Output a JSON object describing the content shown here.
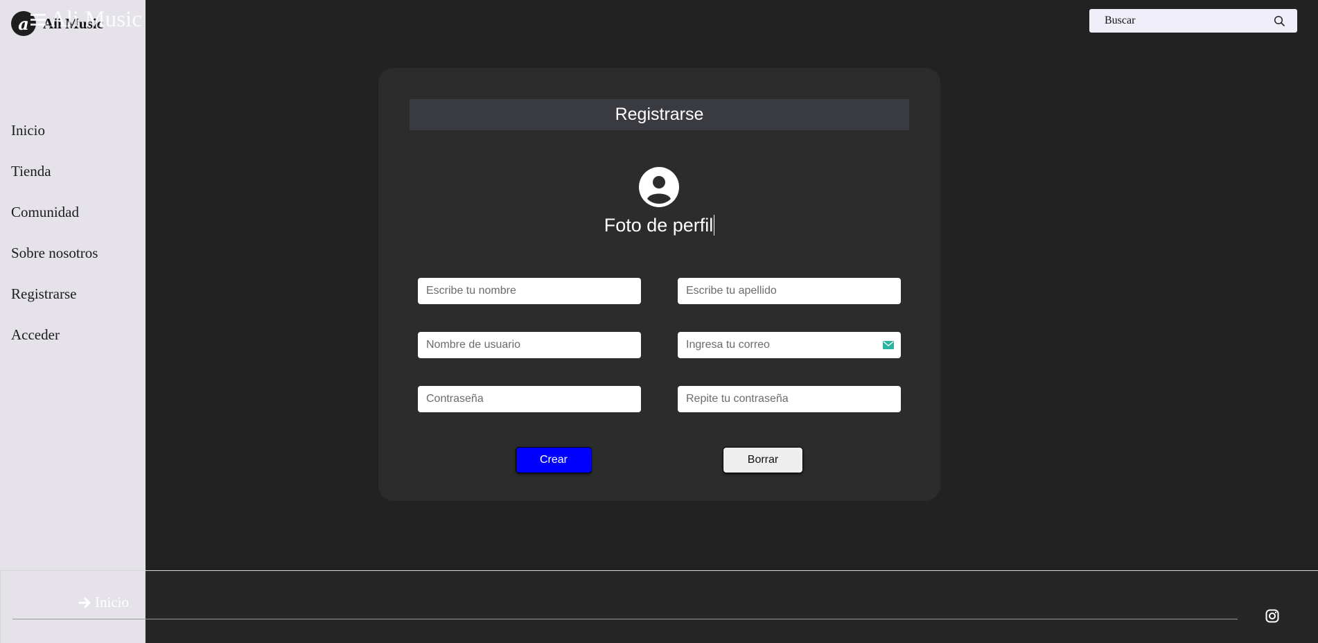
{
  "brand": {
    "logo_letter": "a",
    "name": "Ali Music",
    "ghost_title": "Ali Music"
  },
  "search": {
    "placeholder": "Buscar",
    "icon": "search-icon"
  },
  "nav": {
    "items": [
      {
        "label": "Inicio"
      },
      {
        "label": "Tienda"
      },
      {
        "label": "Comunidad"
      },
      {
        "label": "Sobre nosotros"
      },
      {
        "label": "Registrarse"
      },
      {
        "label": "Acceder"
      }
    ]
  },
  "form": {
    "title": "Registrarse",
    "avatar_icon": "user-avatar-icon",
    "photo_label": "Foto de perfil",
    "fields": {
      "first_name": {
        "placeholder": "Escribe tu nombre"
      },
      "last_name": {
        "placeholder": "Escribe tu apellido"
      },
      "username": {
        "placeholder": "Nombre de usuario"
      },
      "email": {
        "placeholder": "Ingresa tu correo",
        "icon": "mail-icon"
      },
      "password": {
        "placeholder": "Contraseña"
      },
      "password_repeat": {
        "placeholder": "Repite tu contraseña"
      }
    },
    "buttons": {
      "create": "Crear",
      "clear": "Borrar"
    }
  },
  "footer": {
    "link_label": "Inicio",
    "link_icon": "arrow-right-icon",
    "social_icon": "instagram-icon"
  },
  "colors": {
    "background": "#222222",
    "sidebar": "#e5e2ea",
    "card": "#2c2c2c",
    "card_header": "#3a3b41",
    "create_button": "#0000ff",
    "mail_icon": "#2bb5a0"
  }
}
